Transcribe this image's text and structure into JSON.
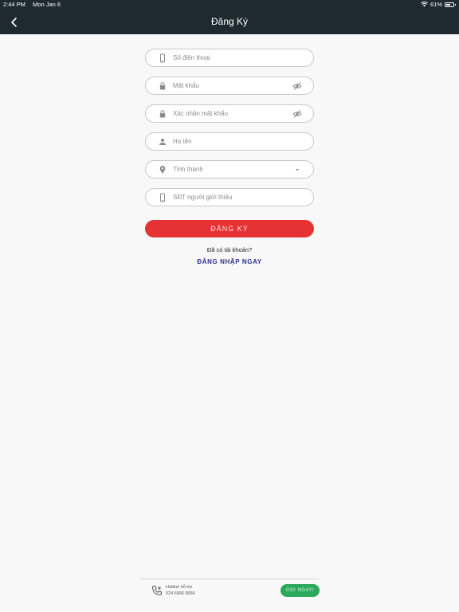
{
  "status_bar": {
    "time": "2:44 PM",
    "date": "Mon Jan 6",
    "battery": "61%",
    "battery_level": 0.61,
    "icons": [
      "wifi-icon",
      "battery-icon"
    ]
  },
  "nav": {
    "title": "Đăng Ký",
    "back_icon": "chevron-left-icon"
  },
  "form": {
    "phone_placeholder": "Số điện thoại",
    "password_placeholder": "Mật khẩu",
    "confirm_password_placeholder": "Xác nhận mật khẩu",
    "fullname_placeholder": "Họ tên",
    "province_placeholder": "Tỉnh thành",
    "referrer_placeholder": "SĐT người giới thiệu"
  },
  "actions": {
    "register_label": "ĐĂNG KÝ",
    "have_account": "Đã có tài khoản?",
    "login_label": "ĐĂNG NHẬP NGAY"
  },
  "footer": {
    "hotline_label": "Hotline hỗ trợ",
    "hotline_number": "024 6666 6666",
    "call_label": "GỌI NGAY!"
  },
  "colors": {
    "header_bg": "#1e2a30",
    "primary_red": "#e63232",
    "link_blue": "#2d3290",
    "call_green": "#2aa85c"
  }
}
